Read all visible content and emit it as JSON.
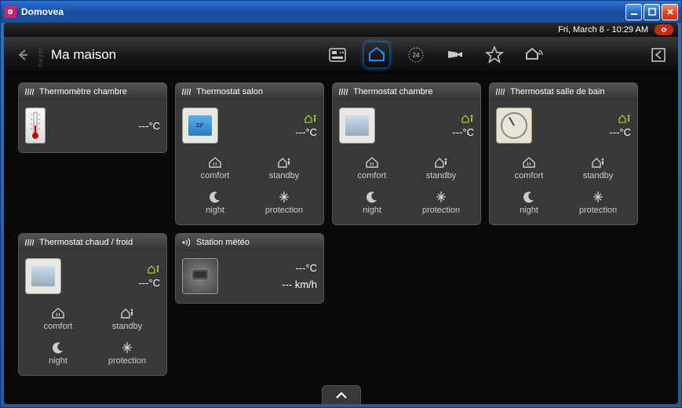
{
  "window": {
    "title": "Domovea"
  },
  "status": {
    "datetime": "Fri, March 8 - 10:29 AM"
  },
  "nav": {
    "brand": ":hager",
    "title": "Ma maison"
  },
  "modes": {
    "comfort": "comfort",
    "standby": "standby",
    "night": "night",
    "protection": "protection"
  },
  "cards": [
    {
      "title": "Thermomètre chambre",
      "temp": "---°C"
    },
    {
      "title": "Thermostat salon",
      "temp": "---°C"
    },
    {
      "title": "Thermostat chambre",
      "temp": "---°C"
    },
    {
      "title": "Thermostat salle de bain",
      "temp": "---°C"
    },
    {
      "title": "Thermostat chaud / froid",
      "temp": "---°C"
    },
    {
      "title": "Station météo",
      "temp": "---°C",
      "wind": "--- km/h"
    }
  ]
}
